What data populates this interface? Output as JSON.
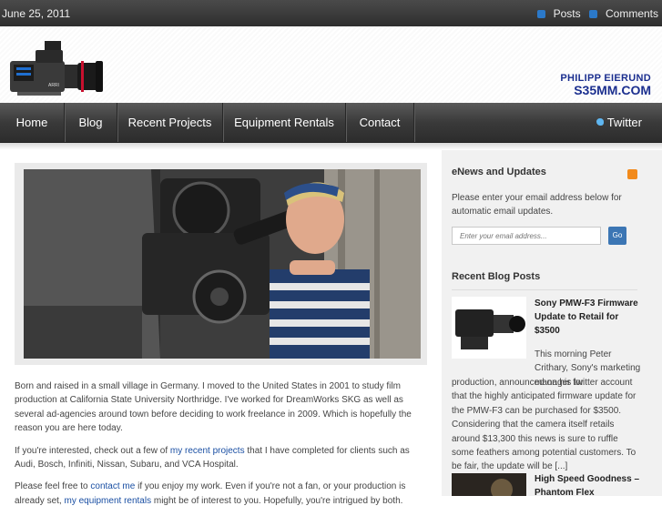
{
  "topbar": {
    "date": "June 25, 2011",
    "posts_label": "Posts",
    "comments_label": "Comments",
    "rss_icon": "rss-icon"
  },
  "header": {
    "brand_line1": "PHILIPP EIERUND",
    "brand_line2": "S35MM.COM",
    "logo_icon": "cinema-camera-logo"
  },
  "nav": {
    "items": [
      {
        "label": "Home"
      },
      {
        "label": "Blog"
      },
      {
        "label": "Recent Projects"
      },
      {
        "label": "Equipment Rentals"
      },
      {
        "label": "Contact"
      }
    ],
    "twitter_label": "Twitter",
    "twitter_icon": "bird-icon"
  },
  "main": {
    "intro": "Born and raised in a small village in Germany. I moved to the United States in 2001 to study film production at California State University Northridge. I've worked for DreamWorks SKG as well as several ad-agencies around town before deciding to work freelance in 2009. Which is hopefully the reason you are here today.",
    "p2_before": "If you're interested, check out a few of ",
    "p2_link": "my recent projects",
    "p2_after": " that I have completed for clients such as Audi, Bosch, Infiniti, Nissan, Subaru, and VCA Hospital.",
    "p3_before": "Please feel free to ",
    "p3_link": "contact me",
    "p3_mid": " if you enjoy my work. Even if you're not a fan, or your production is already set, ",
    "p3_link2": "my equipment rentals",
    "p3_after": " might be of interest to you. Hopefully, you're intrigued by both."
  },
  "sidebar": {
    "enews_title": "eNews and Updates",
    "enews_text": "Please enter your email address below for automatic email updates.",
    "email_placeholder": "Enter your email address...",
    "go_label": "Go",
    "recent_title": "Recent Blog Posts",
    "posts": [
      {
        "title": "Sony PMW-F3 Firmware Update to Retail for $3500",
        "excerpt_top": "This morning Peter Crithary, Sony's marketing manager for",
        "excerpt_rest": "production, announced on his twitter account that the highly anticipated firmware update for the PMW-F3 can be purchased for $3500. Considering that the camera itself retails around $13,300 this news is sure to ruffle some feathers among potential customers. To be fair, the update will be [...]"
      },
      {
        "title": "High Speed Goodness – Phantom Flex"
      }
    ]
  },
  "colors": {
    "brand": "#1b2f8f",
    "link": "#1a4fa3",
    "nav_bg": "#3a3a3a"
  }
}
